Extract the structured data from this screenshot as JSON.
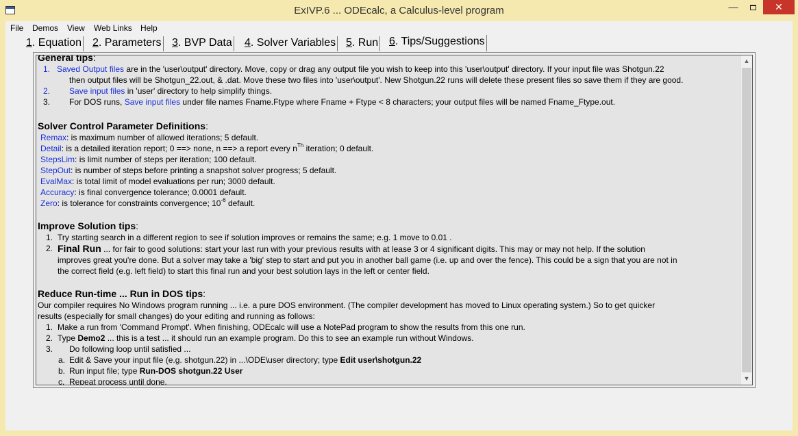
{
  "window": {
    "title": "ExIVP.6 ... ODEcalc, a Calculus-level program",
    "minimize": "—",
    "close": "✕"
  },
  "menu": [
    "File",
    "Demos",
    "View",
    "Web Links",
    "Help"
  ],
  "tabs": [
    {
      "num": "1",
      "label": ". Equation"
    },
    {
      "num": "2",
      "label": ". Parameters"
    },
    {
      "num": "3",
      "label": ". BVP Data"
    },
    {
      "num": "4",
      "label": ". Solver Variables"
    },
    {
      "num": "5",
      "label": ". Run"
    },
    {
      "num": "6",
      "label": ". Tips/Suggestions"
    }
  ],
  "active_tab": "6",
  "scrollbar": {
    "up": "▲",
    "down": "▼"
  },
  "general_tips": {
    "heading": "General tips",
    "items": [
      {
        "num": "1.",
        "link": "Saved Output files",
        "text1": " are in the 'user\\output' directory.  Move, copy or drag any output file you wish to keep into this 'user\\output' directory.  If your input file was Shotgun.22",
        "text2": "then output files will be Shotgun_22.out, & .dat.  Move these two files into 'user\\output'.  New Shotgun.22 runs will delete these present files so save them if they are good."
      },
      {
        "num": "2.",
        "link": "Save input files",
        "text": " in 'user' directory to help simplify things."
      },
      {
        "num": "3.",
        "pre": "For DOS runs, ",
        "link": "Save input files",
        "text": " under file names Fname.Ftype where Fname + Ftype < 8 characters; your output files will be named Fname_Ftype.out."
      }
    ]
  },
  "solver_params": {
    "heading": "Solver Control Parameter Definitions",
    "items": [
      {
        "term": "Remax",
        "def": ": is maximum number of allowed iterations; 5 default."
      },
      {
        "term": "Detail",
        "def_a": ": is a detailed iteration report; 0 ==> none, n ==> a report every n",
        "sup": "Th",
        "def_b": " iteration; 0 default."
      },
      {
        "term": "StepsLim",
        "def": ": is limit number of steps per iteration; 100 default."
      },
      {
        "term": "StepOut",
        "def": ": is number of steps before printing a snapshot solver progress; 5 default."
      },
      {
        "term": "EvalMax",
        "def": ": is total limit of model evaluations per run; 3000 default."
      },
      {
        "term": "Accuracy",
        "def": ": is final convergence tolerance; 0.0001 default."
      },
      {
        "term": "Zero",
        "def_a": ": is tolerance for constraints convergence; 10",
        "sup": "-6",
        "def_b": " default."
      }
    ]
  },
  "improve": {
    "heading": "Improve Solution tips",
    "item1": {
      "num": "1.",
      "text": "Try starting search in a different region to see if solution improves or remains the same; e.g. 1 move to 0.01 ."
    },
    "item2": {
      "num": "2.",
      "bold": "Final Run",
      "line1": " ... for fair to good solutions: start your last run with your previous results with at lease 3 or 4 significant digits. This may or may not help. If the solution",
      "line2": "improves great you're done. But a solver may take a 'big' step to start and put you in another ball game (i.e. up and over the fence). This could be a sign that you are not in",
      "line3": "the correct field (e.g. left field) to start this final run and your best solution lays in the left or center field."
    }
  },
  "reduce": {
    "heading": "Reduce Run-time ... Run in DOS tips",
    "intro1": "Our compiler requires No Windows program running ... i.e. a pure DOS environment. (The compiler development has moved to Linux operating system.) So to get quicker",
    "intro2": "results (especially for small changes) do your editing and running as follows:",
    "item1": {
      "num": "1.",
      "text": "Make a run from 'Command Prompt'. When finishing, ODEcalc will use a NotePad program to show the results from this one run."
    },
    "item2": {
      "num": "2.",
      "pre": "Type ",
      "bold": "Demo2",
      "text": " ... this is a test ... it should run an example program. Do this to see an example run without Windows."
    },
    "item3": {
      "num": "3.",
      "text": "Do following loop until satisfied ..."
    },
    "sub_a": {
      "num": "a.",
      "text": "Edit & Save your input file (e.g. shotgun.22) in ...\\ODE\\user directory; type ",
      "bold": "Edit user\\shotgun.22"
    },
    "sub_b": {
      "num": "b.",
      "text": "Run input file; type ",
      "bold": "Run-DOS shotgun.22  User"
    },
    "sub_c": {
      "num": "c.",
      "text": "Repeat process until done."
    }
  }
}
